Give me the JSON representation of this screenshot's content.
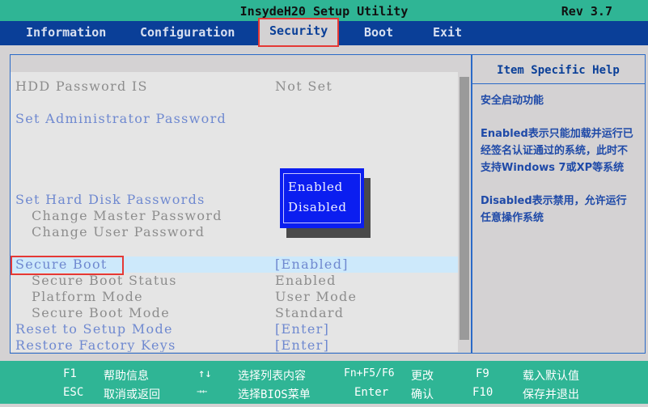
{
  "header": {
    "title": "InsydeH20 Setup Utility",
    "rev": "Rev 3.7"
  },
  "tabs": [
    "Information",
    "Configuration",
    "Security",
    "Boot",
    "Exit"
  ],
  "active_tab": "Security",
  "rows": [
    {
      "label": "HDD Password IS",
      "value": "Not Set",
      "style": "gray"
    },
    {
      "label": "Set Administrator Password",
      "value": "",
      "style": "link"
    },
    {
      "label": "Set Hard Disk Passwords",
      "value": "",
      "style": "link"
    },
    {
      "label": "Change Master Password",
      "value": "",
      "style": "gray"
    },
    {
      "label": "Change User Password",
      "value": "",
      "style": "gray"
    },
    {
      "label": "Secure Boot",
      "value": "[Enabled]",
      "style": "link"
    },
    {
      "label": "Secure Boot Status",
      "value": "Enabled",
      "style": "gray"
    },
    {
      "label": "Platform Mode",
      "value": "User Mode",
      "style": "gray"
    },
    {
      "label": "Secure Boot Mode",
      "value": "Standard",
      "style": "gray"
    },
    {
      "label": "Reset to Setup Mode",
      "value": "[Enter]",
      "style": "link"
    },
    {
      "label": "Restore Factory Keys",
      "value": "[Enter]",
      "style": "link"
    }
  ],
  "popup": {
    "options": [
      "Enabled",
      "Disabled"
    ]
  },
  "help": {
    "title": "Item Specific Help",
    "paragraphs": [
      "安全启动功能",
      "Enabled表示只能加载并运行已经签名认证通过的系统，此时不支持Windows 7或XP等系统",
      "Disabled表示禁用，允许运行任意操作系统"
    ]
  },
  "footer": [
    {
      "key": "F1",
      "desc": "帮助信息"
    },
    {
      "key": "↑↓",
      "desc": "选择列表内容"
    },
    {
      "key": "Fn+F5/F6",
      "desc": "更改"
    },
    {
      "key": "F9",
      "desc": "载入默认值"
    },
    {
      "key": "ESC",
      "desc": "取消或返回"
    },
    {
      "key": "→←",
      "desc": "选择BIOS菜单"
    },
    {
      "key": "Enter",
      "desc": "确认"
    },
    {
      "key": "F10",
      "desc": "保存并退出"
    }
  ],
  "colors": {
    "teal": "#2fb595",
    "navy": "#0a3f98",
    "highlight": "#e53935"
  }
}
